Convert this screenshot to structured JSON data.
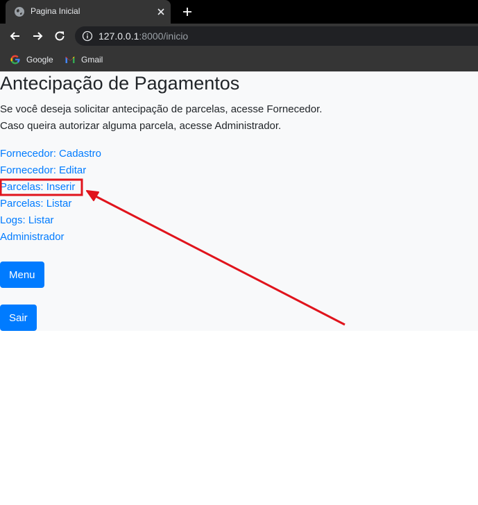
{
  "browser": {
    "tab_title": "Pagina Inicial",
    "url_host": "127.0.0.1",
    "url_path": ":8000/inicio",
    "bookmarks": [
      {
        "label": "Google"
      },
      {
        "label": "Gmail"
      }
    ]
  },
  "page": {
    "title": "Antecipação de Pagamentos",
    "intro_line1": "Se você deseja solicitar antecipação de parcelas, acesse Fornecedor.",
    "intro_line2": "Caso queira autorizar alguma parcela, acesse Administrador.",
    "links": [
      {
        "label": "Fornecedor: Cadastro"
      },
      {
        "label": "Fornecedor: Editar"
      },
      {
        "label": "Parcelas: Inserir"
      },
      {
        "label": "Parcelas: Listar"
      },
      {
        "label": "Logs: Listar"
      },
      {
        "label": "Administrador"
      }
    ],
    "menu_button": "Menu",
    "logout_button": "Sair"
  },
  "colors": {
    "link": "#007bff",
    "button": "#007bff",
    "annotation": "#e0141c",
    "page_bg": "#f8f9fa",
    "chrome_bg": "#353535"
  },
  "icons": {
    "tab_favicon": "globe-icon",
    "tab_close": "close-icon",
    "new_tab": "plus-icon",
    "back": "arrow-left-icon",
    "forward": "arrow-right-icon",
    "reload": "reload-icon",
    "site_info": "info-icon",
    "google": "google-icon",
    "gmail": "gmail-icon"
  }
}
